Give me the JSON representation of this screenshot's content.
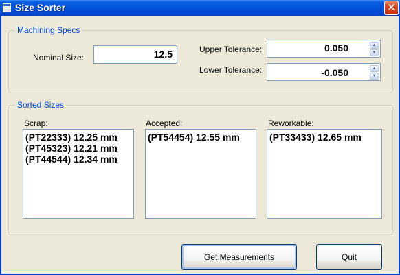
{
  "window": {
    "title": "Size Sorter",
    "close_glyph": "✕"
  },
  "specs": {
    "legend": "Machining Specs",
    "nominal_label": "Nominal Size:",
    "nominal_value": "12.5",
    "upper_label": "Upper Tolerance:",
    "upper_value": "0.050",
    "lower_label": "Lower Tolerance:",
    "lower_value": "-0.050",
    "spin_up": "▲",
    "spin_down": "▼"
  },
  "sorted": {
    "legend": "Sorted Sizes",
    "scrap": {
      "label": "Scrap:",
      "items": [
        "(PT22333) 12.25 mm",
        "(PT45323) 12.21 mm",
        "(PT44544) 12.34 mm"
      ]
    },
    "accepted": {
      "label": "Accepted:",
      "items": [
        "(PT54454) 12.55 mm"
      ]
    },
    "reworkable": {
      "label": "Reworkable:",
      "items": [
        "(PT33433) 12.65 mm"
      ]
    }
  },
  "buttons": {
    "get_measurements": "Get Measurements",
    "quit": "Quit"
  },
  "colors": {
    "title_bar": "#0353da",
    "group_legend": "#0046d5",
    "face": "#ece9d8"
  }
}
